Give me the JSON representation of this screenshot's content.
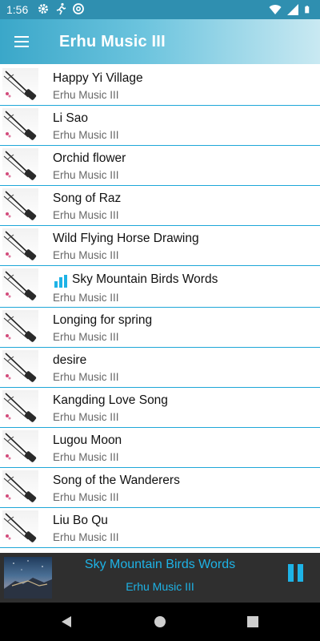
{
  "status_bar": {
    "time": "1:56",
    "left_icons": [
      "gear-icon",
      "running-icon",
      "at-icon"
    ],
    "right_icons": [
      "wifi-icon",
      "signal-icon",
      "battery-icon"
    ]
  },
  "app_bar": {
    "title": "Erhu Music III",
    "menu_icon": "hamburger-menu-icon"
  },
  "songs": [
    {
      "title": "Happy Yi Village",
      "artist": "Erhu Music III",
      "playing": false
    },
    {
      "title": "Li Sao",
      "artist": "Erhu Music III",
      "playing": false
    },
    {
      "title": "Orchid flower",
      "artist": "Erhu Music III",
      "playing": false
    },
    {
      "title": "Song of Raz",
      "artist": "Erhu Music III",
      "playing": false
    },
    {
      "title": "Wild Flying Horse Drawing",
      "artist": "Erhu Music III",
      "playing": false
    },
    {
      "title": "Sky Mountain Birds Words",
      "artist": "Erhu Music III",
      "playing": true
    },
    {
      "title": "Longing for spring",
      "artist": "Erhu Music III",
      "playing": false
    },
    {
      "title": "desire",
      "artist": "Erhu Music III",
      "playing": false
    },
    {
      "title": "Kangding Love Song",
      "artist": "Erhu Music III",
      "playing": false
    },
    {
      "title": "Lugou Moon",
      "artist": "Erhu Music III",
      "playing": false
    },
    {
      "title": "Song of the Wanderers",
      "artist": "Erhu Music III",
      "playing": false
    },
    {
      "title": "Liu Bo Qu",
      "artist": "Erhu Music III",
      "playing": false
    }
  ],
  "now_playing": {
    "title": "Sky Mountain Birds Words",
    "artist": "Erhu Music III",
    "control_icon": "pause-icon"
  },
  "nav_bar": {
    "buttons": [
      "back-icon",
      "home-icon",
      "recents-icon"
    ]
  },
  "colors": {
    "accent": "#1eb3e6",
    "divider": "#1ea7d8",
    "status_bar": "#2f8fb0",
    "player_bg": "#2f2f2f"
  }
}
